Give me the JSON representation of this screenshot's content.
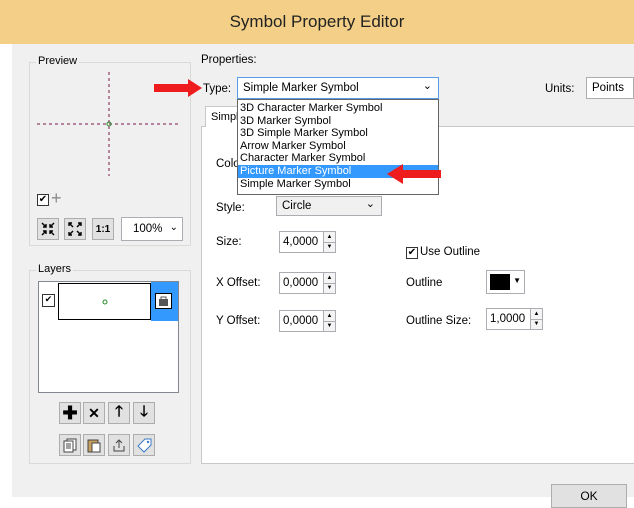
{
  "window": {
    "title": "Symbol Property Editor"
  },
  "preview": {
    "label": "Preview",
    "zoom_value": "100%"
  },
  "layers": {
    "label": "Layers"
  },
  "properties": {
    "label": "Properties:",
    "type_label": "Type:",
    "type_value": "Simple Marker Symbol",
    "units_label": "Units:",
    "units_value": "Points",
    "type_options": [
      "3D Character Marker Symbol",
      "3D Marker Symbol",
      "3D Simple Marker Symbol",
      "Arrow Marker Symbol",
      "Character Marker Symbol",
      "Picture Marker Symbol",
      "Simple Marker Symbol"
    ],
    "selected_option_index": 5,
    "tab_label": "Simple",
    "color_label": "Colo",
    "style_label": "Style:",
    "style_value": "Circle",
    "size_label": "Size:",
    "size_value": "4,0000",
    "use_outline_label": "Use Outline",
    "use_outline_checked": true,
    "xoffset_label": "X Offset:",
    "xoffset_value": "0,0000",
    "outline_label": "Outline",
    "outline_color": "#000000",
    "yoffset_label": "Y Offset:",
    "yoffset_value": "0,0000",
    "outline_size_label": "Outline Size:",
    "outline_size_value": "1,0000"
  },
  "buttons": {
    "ok_label": "OK"
  },
  "colors": {
    "title_bar": "#f4cf87",
    "arrow": "#ee1c1c",
    "selection": "#3399ff",
    "layer_selected": "#3399ff"
  }
}
